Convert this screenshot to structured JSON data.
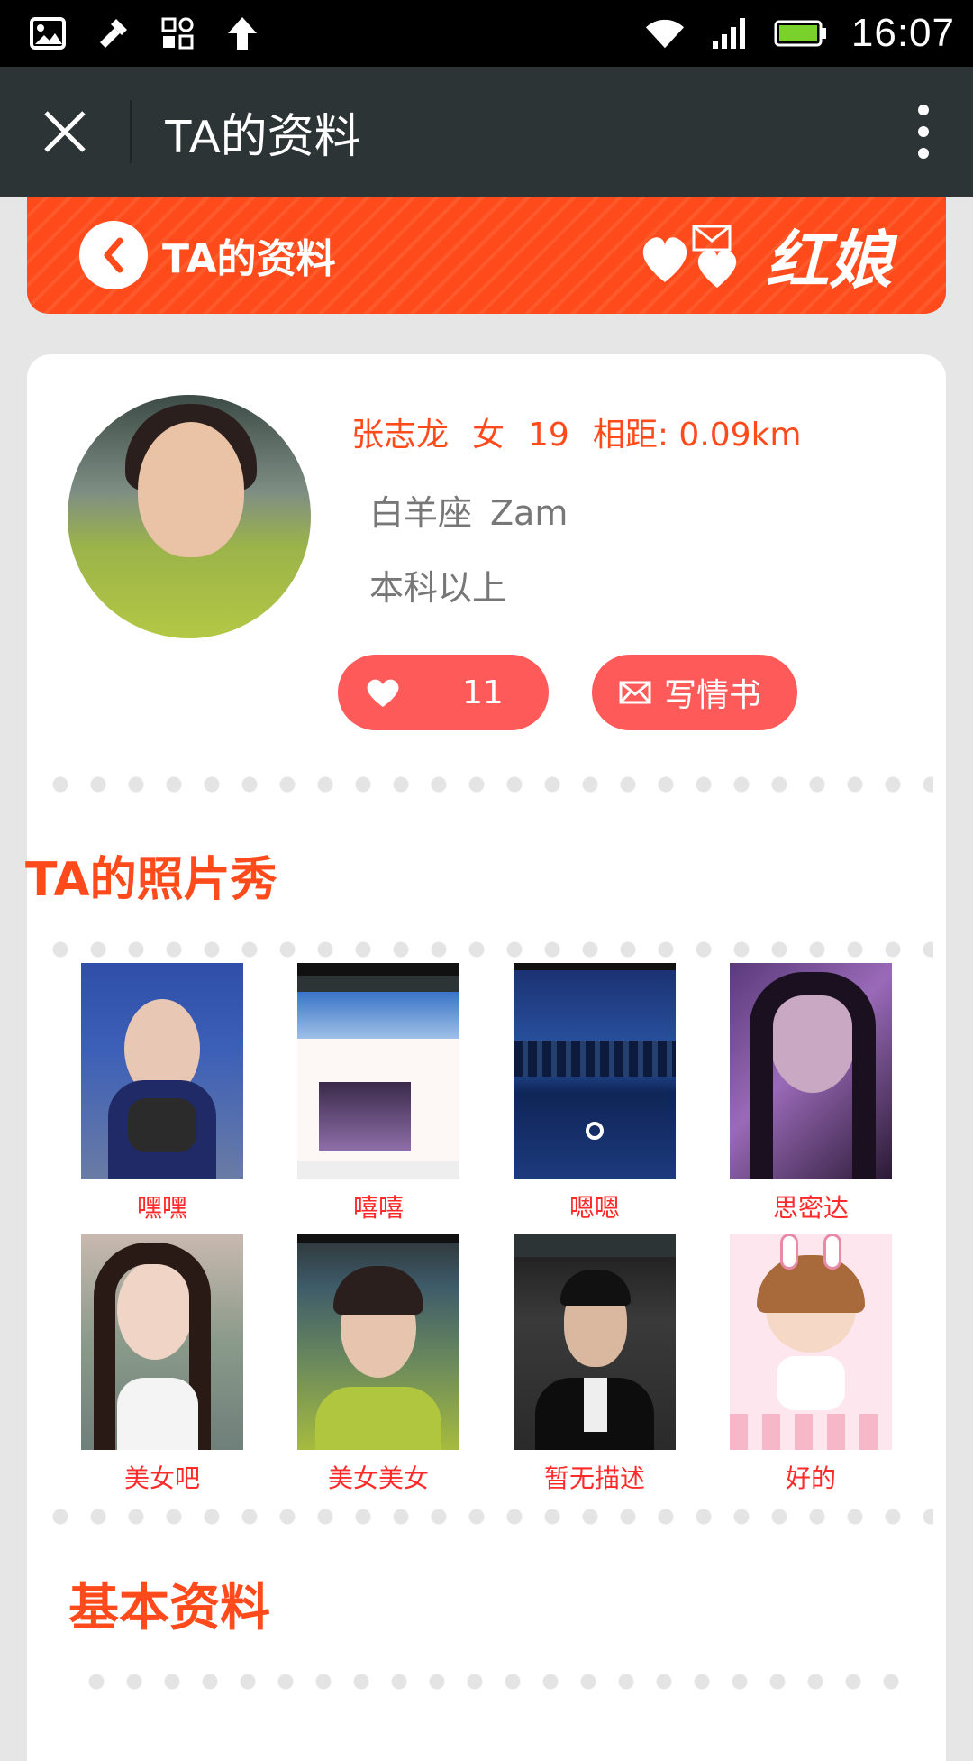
{
  "status_bar": {
    "time": "16:07",
    "icons": [
      "image-icon",
      "tools-icon",
      "apps-icon",
      "upload-arrow-icon",
      "wifi-icon",
      "signal-icon",
      "battery-icon"
    ]
  },
  "title_bar": {
    "title": "TA的资料",
    "close_icon": "close-icon",
    "menu_icon": "more-vertical-icon"
  },
  "banner": {
    "title": "TA的资料",
    "logo_text": "红娘",
    "color": "#ff4a1c"
  },
  "profile": {
    "name": "张志龙",
    "gender": "女",
    "age": "19",
    "distance": "相距: 0.09km",
    "zodiac": "白羊座",
    "nickname": "Zam",
    "education": "本科以上",
    "like_count": "11",
    "write_letter": "写情书"
  },
  "photo_section": {
    "title": "TA的照片秀",
    "photos": [
      {
        "caption": "嘿嘿"
      },
      {
        "caption": "嘻嘻"
      },
      {
        "caption": "嗯嗯"
      },
      {
        "caption": "思密达"
      },
      {
        "caption": "美女吧"
      },
      {
        "caption": "美女美女"
      },
      {
        "caption": "暂无描述"
      },
      {
        "caption": "好的"
      }
    ]
  },
  "basic_section": {
    "title": "基本资料"
  },
  "colors": {
    "accent": "#ff4a1c",
    "button": "#ff5a5a",
    "caption": "#ff2a2a"
  }
}
